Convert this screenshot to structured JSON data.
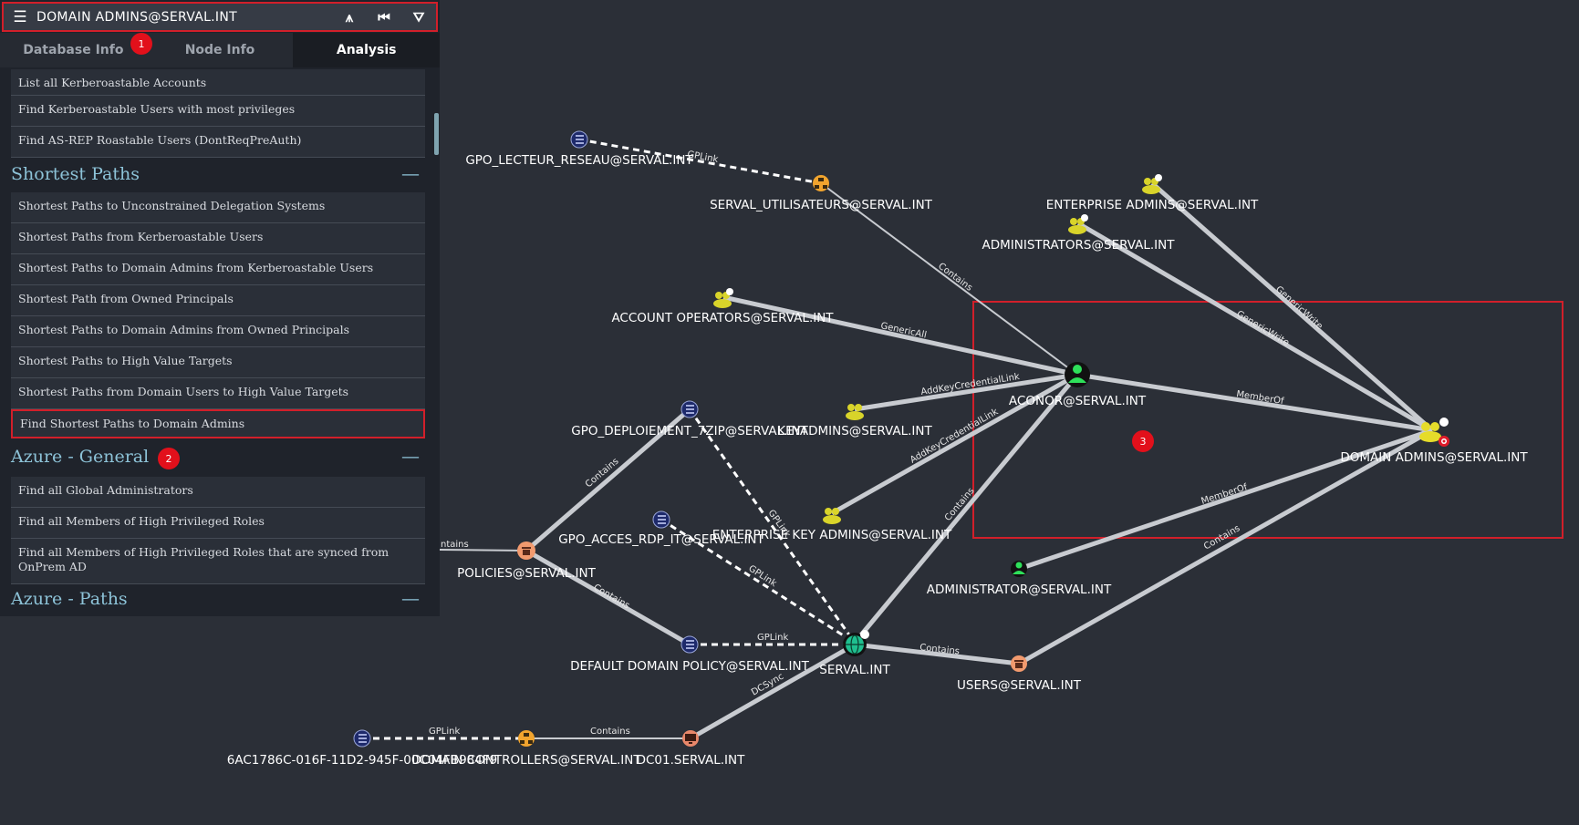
{
  "search": {
    "value": "DOMAIN ADMINS@SERVAL.INT"
  },
  "tabs": [
    {
      "label": "Database Info"
    },
    {
      "label": "Node Info"
    },
    {
      "label": "Analysis"
    }
  ],
  "queries_top": [
    "List all Kerberoastable Accounts",
    "Find Kerberoastable Users with most privileges",
    "Find AS-REP Roastable Users (DontReqPreAuth)"
  ],
  "sections": {
    "shortest": "Shortest Paths",
    "azure_general": "Azure - General",
    "azure_paths": "Azure - Paths"
  },
  "shortest_paths": [
    "Shortest Paths to Unconstrained Delegation Systems",
    "Shortest Paths from Kerberoastable Users",
    "Shortest Paths to Domain Admins from Kerberoastable Users",
    "Shortest Path from Owned Principals",
    "Shortest Paths to Domain Admins from Owned Principals",
    "Shortest Paths to High Value Targets",
    "Shortest Paths from Domain Users to High Value Targets",
    "Find Shortest Paths to Domain Admins"
  ],
  "azure_general": [
    "Find all Global Administrators",
    "Find all Members of High Privileged Roles",
    "Find all Members of High Privileged Roles that are synced from OnPrem AD"
  ],
  "badges": [
    "1",
    "2",
    "3"
  ],
  "colors": {
    "highlight": "#d21f2a",
    "badge": "#e2101b",
    "section": "#8dc3d8"
  },
  "graph": {
    "nodes": [
      {
        "id": "gpo_lecteur",
        "label": "GPO_LECTEUR_RESEAU@SERVAL.INT",
        "type": "gpo"
      },
      {
        "id": "serval_util",
        "label": "SERVAL_UTILISATEURS@SERVAL.INT",
        "type": "ou"
      },
      {
        "id": "ent_admins",
        "label": "ENTERPRISE ADMINS@SERVAL.INT",
        "type": "group-hv"
      },
      {
        "id": "administrators",
        "label": "ADMINISTRATORS@SERVAL.INT",
        "type": "group-hv"
      },
      {
        "id": "acct_ops",
        "label": "ACCOUNT OPERATORS@SERVAL.INT",
        "type": "group-hv"
      },
      {
        "id": "aconor",
        "label": "ACONOR@SERVAL.INT",
        "type": "user"
      },
      {
        "id": "keyadmins",
        "label": "KEYADMINS@SERVAL.INT",
        "type": "group"
      },
      {
        "id": "domain_admins",
        "label": "DOMAIN ADMINS@SERVAL.INT",
        "type": "group-target"
      },
      {
        "id": "gpo_deploy",
        "label": "GPO_DEPLOIEMENT_7ZIP@SERVAL.INT",
        "type": "gpo"
      },
      {
        "id": "ent_key_admins",
        "label": "ENTERPRISE KEY ADMINS@SERVAL.INT",
        "type": "group"
      },
      {
        "id": "gpo_rdp",
        "label": "GPO_ACCES_RDP_IT@SERVAL.INT",
        "type": "gpo"
      },
      {
        "id": "policies",
        "label": "POLICIES@SERVAL.INT",
        "type": "container"
      },
      {
        "id": "administrator",
        "label": "ADMINISTRATOR@SERVAL.INT",
        "type": "user"
      },
      {
        "id": "default_policy",
        "label": "DEFAULT DOMAIN POLICY@SERVAL.INT",
        "type": "gpo"
      },
      {
        "id": "serval",
        "label": "SERVAL.INT",
        "type": "domain"
      },
      {
        "id": "users",
        "label": "USERS@SERVAL.INT",
        "type": "container"
      },
      {
        "id": "gpo_guid",
        "label": "6AC1786C-016F-11D2-945F-00C04FB984F9",
        "type": "gpo"
      },
      {
        "id": "dom_controllers",
        "label": "DOMAIN CONTROLLERS@SERVAL.INT",
        "type": "ou"
      },
      {
        "id": "dc01",
        "label": "DC01.SERVAL.INT",
        "type": "computer"
      }
    ],
    "edge_labels": [
      "GPLink",
      "Contains",
      "GenericWrite",
      "GenericWrite",
      "GenericAll",
      "AddKeyCredentialLink",
      "MemberOf",
      "AddKeyCredentialLink",
      "Contains",
      "Contains",
      "GPLink",
      "GPLink",
      "Contains",
      "MemberOf",
      "Contains",
      "GPLink",
      "Contains",
      "DCSync",
      "GPLink",
      "Contains",
      "ntains"
    ]
  }
}
